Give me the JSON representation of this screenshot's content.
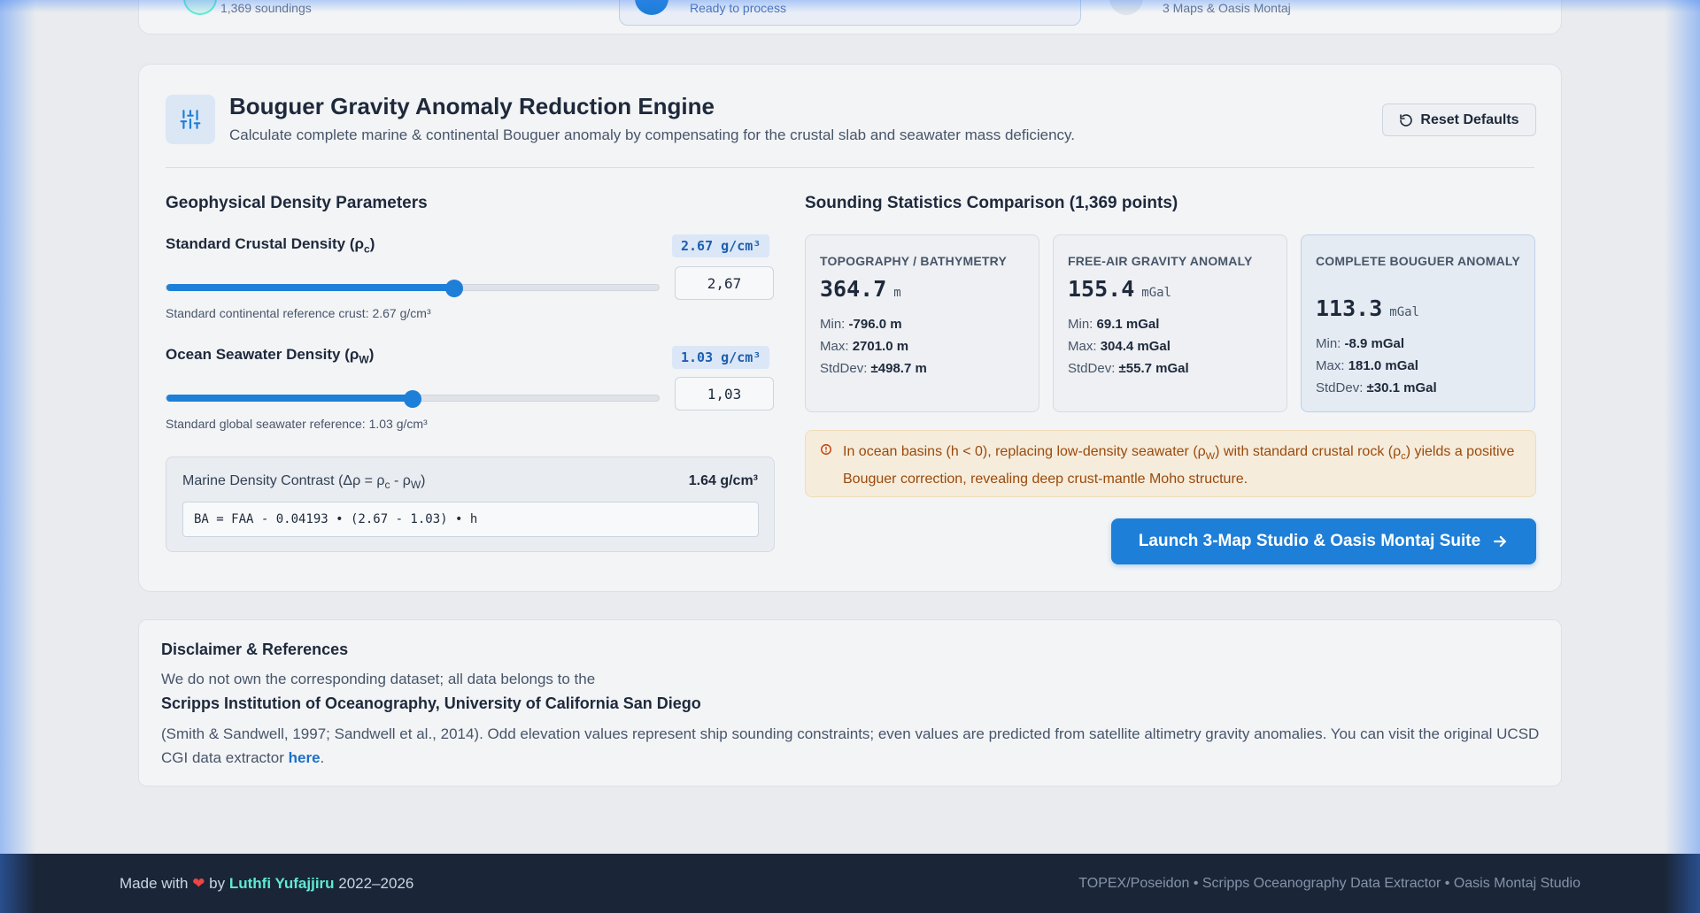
{
  "top_strip": {
    "item1_text": "1,369 soundings",
    "item2_text": "Ready to process",
    "item3_text": "3 Maps & Oasis Montaj"
  },
  "engine": {
    "title": "Bouguer Gravity Anomaly Reduction Engine",
    "subtitle": "Calculate complete marine & continental Bouguer anomaly by compensating for the crustal slab and seawater mass deficiency.",
    "reset_label": "Reset Defaults",
    "params_title": "Geophysical Density Parameters",
    "crust": {
      "label": "Standard Crustal Density (ρ",
      "sub": "c",
      "label_end": ")",
      "badge": "2.67 g/cm³",
      "input_value": "2,67",
      "note": "Standard continental reference crust: 2.67 g/cm³",
      "slider_fraction": 0.585
    },
    "water": {
      "label": "Ocean Seawater Density (ρ",
      "sub": "W",
      "label_end": ")",
      "badge": "1.03 g/cm³",
      "input_value": "1,03",
      "note": "Standard global seawater reference: 1.03 g/cm³",
      "slider_fraction": 0.5
    },
    "contrast": {
      "label_a": "Marine Density Contrast (Δρ = ρ",
      "sub_a": "c",
      "label_b": " - ρ",
      "sub_b": "W",
      "label_c": ")",
      "value": "1.64 g/cm³",
      "formula": "BA = FAA - 0.04193 • (2.67 - 1.03) • h"
    },
    "stats_title": "Sounding Statistics Comparison (1,369 points)",
    "stats": [
      {
        "head": "TOPOGRAPHY / BATHYMETRY",
        "value": "364.7",
        "unit": "m",
        "min_label": "Min: ",
        "min": "-796.0 m",
        "max_label": "Max: ",
        "max": "2701.0 m",
        "std_label": "StdDev: ",
        "std": "±498.7 m"
      },
      {
        "head": "FREE-AIR GRAVITY ANOMALY",
        "value": "155.4",
        "unit": "mGal",
        "min_label": "Min: ",
        "min": "69.1 mGal",
        "max_label": "Max: ",
        "max": "304.4 mGal",
        "std_label": "StdDev: ",
        "std": "±55.7 mGal"
      },
      {
        "head": "COMPLETE BOUGUER ANOMALY",
        "value": "113.3",
        "unit": "mGal",
        "min_label": "Min: ",
        "min": "-8.9 mGal",
        "max_label": "Max: ",
        "max": "181.0 mGal",
        "std_label": "StdDev: ",
        "std": "±30.1 mGal"
      }
    ],
    "warning": {
      "part1": "In ocean basins (h < 0), replacing low-density seawater (ρ",
      "sub1": "W",
      "part2": ") with standard crustal rock (ρ",
      "sub2": "c",
      "part3": ") yields a positive Bouguer correction, revealing deep crust-mantle Moho structure."
    },
    "launch_label": "Launch 3-Map Studio & Oasis Montaj Suite"
  },
  "disclaimer": {
    "title": "Disclaimer & References",
    "line1": "We do not own the corresponding dataset; all data belongs to the",
    "institution": "Scripps Institution of Oceanography, University of California San Diego",
    "text": "(Smith & Sandwell, 1997; Sandwell et al., 2014). Odd elevation values represent ship sounding constraints; even values are predicted from satellite altimetry gravity anomalies. You can visit the original UCSD CGI data extractor ",
    "link": "here",
    "text_end": "."
  },
  "footer": {
    "made_with": "Made with ",
    "heart": "❤",
    "by": " by ",
    "author": "Luthfi Yufajjiru",
    "years": " 2022–2026",
    "right": "TOPEX/Poseidon • Scripps Oceanography Data Extractor • Oasis Montaj Studio"
  },
  "colors": {
    "accent": "#1e7fd8",
    "warning_text": "#9a4a0c",
    "footer_bg": "#1a2538",
    "author": "#5eead4"
  }
}
